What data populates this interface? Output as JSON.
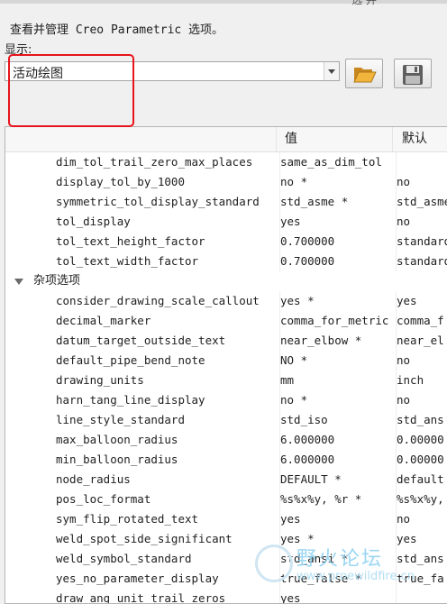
{
  "window": {
    "title_fragment": "选 并"
  },
  "description": "查看并管理 Creo Parametric 选项。",
  "show_label": "显示:",
  "combo": {
    "value": "活动绘图"
  },
  "toolbar": {
    "open_icon": "folder-open-icon",
    "save_icon": "save-icon"
  },
  "table": {
    "headers": {
      "name": "",
      "value": "值",
      "default": "默认"
    },
    "rows": [
      {
        "type": "option",
        "name": "dim_tol_trail_zero_max_places",
        "value": "same_as_dim_tol",
        "default": ""
      },
      {
        "type": "option",
        "name": "display_tol_by_1000",
        "value": "no *",
        "default": "no"
      },
      {
        "type": "option",
        "name": "symmetric_tol_display_standard",
        "value": "std_asme *",
        "default": "std_asme"
      },
      {
        "type": "option",
        "name": "tol_display",
        "value": "yes",
        "default": "no"
      },
      {
        "type": "option",
        "name": "tol_text_height_factor",
        "value": "0.700000",
        "default": "standard"
      },
      {
        "type": "option",
        "name": "tol_text_width_factor",
        "value": "0.700000",
        "default": "standard"
      },
      {
        "type": "group",
        "name": "杂项选项"
      },
      {
        "type": "option",
        "name": "consider_drawing_scale_callout",
        "value": "yes *",
        "default": "yes"
      },
      {
        "type": "option",
        "name": "decimal_marker",
        "value": "comma_for_metric",
        "default": "comma_f"
      },
      {
        "type": "option",
        "name": "datum_target_outside_text",
        "value": "near_elbow *",
        "default": "near_el"
      },
      {
        "type": "option",
        "name": "default_pipe_bend_note",
        "value": "NO *",
        "default": "no"
      },
      {
        "type": "option",
        "name": "drawing_units",
        "value": "mm",
        "default": "inch"
      },
      {
        "type": "option",
        "name": "harn_tang_line_display",
        "value": "no *",
        "default": "no"
      },
      {
        "type": "option",
        "name": "line_style_standard",
        "value": "std_iso",
        "default": "std_ans"
      },
      {
        "type": "option",
        "name": "max_balloon_radius",
        "value": "6.000000",
        "default": "0.00000"
      },
      {
        "type": "option",
        "name": "min_balloon_radius",
        "value": "6.000000",
        "default": "0.00000"
      },
      {
        "type": "option",
        "name": "node_radius",
        "value": "DEFAULT *",
        "default": "default"
      },
      {
        "type": "option",
        "name": "pos_loc_format",
        "value": "%s%x%y, %r *",
        "default": "%s%x%y,"
      },
      {
        "type": "option",
        "name": "sym_flip_rotated_text",
        "value": "yes",
        "default": "no"
      },
      {
        "type": "option",
        "name": "weld_spot_side_significant",
        "value": "yes *",
        "default": "yes"
      },
      {
        "type": "option",
        "name": "weld_symbol_standard",
        "value": "std_ansi *",
        "default": "std_ans"
      },
      {
        "type": "option",
        "name": "yes_no_parameter_display",
        "value": "true_false *",
        "default": "true_fa"
      },
      {
        "type": "option",
        "name": "draw_ang_unit_trail_zeros",
        "value": "yes",
        "default": ""
      }
    ]
  },
  "watermark": {
    "text": "野火论坛",
    "url": "www.proewildfire.cn"
  },
  "colors": {
    "highlight": "#e8141c",
    "folder": "#e8a32c",
    "save": "#5a5a5a"
  }
}
